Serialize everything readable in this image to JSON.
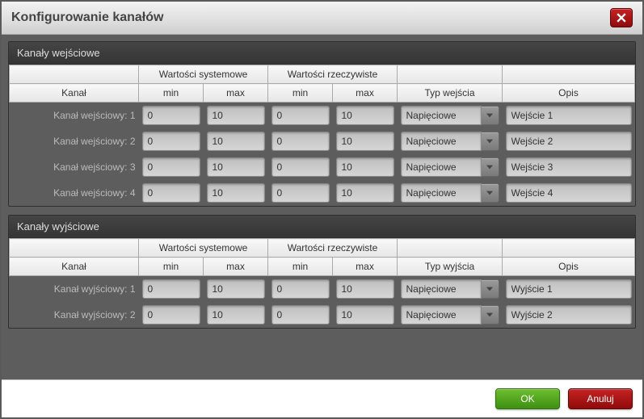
{
  "title": "Konfigurowanie kanałów",
  "headers": {
    "system_values": "Wartości systemowe",
    "real_values": "Wartości rzeczywiste",
    "channel": "Kanał",
    "min": "min",
    "max": "max",
    "type_in": "Typ wejścia",
    "type_out": "Typ wyjścia",
    "desc": "Opis"
  },
  "buttons": {
    "ok": "OK",
    "cancel": "Anuluj"
  },
  "input_section": {
    "title": "Kanały wejściowe",
    "rows": [
      {
        "label": "Kanał wejściowy: 1",
        "sys_min": "0",
        "sys_max": "10",
        "real_min": "0",
        "real_max": "10",
        "type": "Napięciowe",
        "desc": "Wejście 1"
      },
      {
        "label": "Kanał wejściowy: 2",
        "sys_min": "0",
        "sys_max": "10",
        "real_min": "0",
        "real_max": "10",
        "type": "Napięciowe",
        "desc": "Wejście 2"
      },
      {
        "label": "Kanał wejściowy: 3",
        "sys_min": "0",
        "sys_max": "10",
        "real_min": "0",
        "real_max": "10",
        "type": "Napięciowe",
        "desc": "Wejście 3"
      },
      {
        "label": "Kanał wejściowy: 4",
        "sys_min": "0",
        "sys_max": "10",
        "real_min": "0",
        "real_max": "10",
        "type": "Napięciowe",
        "desc": "Wejście 4"
      }
    ]
  },
  "output_section": {
    "title": "Kanały wyjściowe",
    "rows": [
      {
        "label": "Kanał wyjściowy: 1",
        "sys_min": "0",
        "sys_max": "10",
        "real_min": "0",
        "real_max": "10",
        "type": "Napięciowe",
        "desc": "Wyjście 1"
      },
      {
        "label": "Kanał wyjściowy: 2",
        "sys_min": "0",
        "sys_max": "10",
        "real_min": "0",
        "real_max": "10",
        "type": "Napięciowe",
        "desc": "Wyjście 2"
      }
    ]
  }
}
